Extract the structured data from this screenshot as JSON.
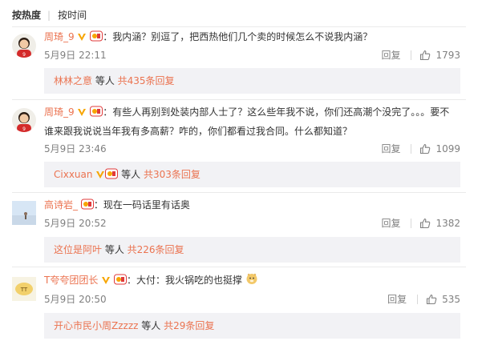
{
  "sort": {
    "hot": "按热度",
    "time": "按时间"
  },
  "comments": [
    {
      "name": "周琦_9",
      "text": "：我内涵？别逗了，把西热他们几个卖的时候怎么不说我内涵？",
      "time": "5月9日 22:11",
      "reply": "回复",
      "likes": "1793",
      "reply_name": "林林之意",
      "reply_mid": " 等人 ",
      "reply_count": "共435条回复"
    },
    {
      "name": "周琦_9",
      "text1": "：有些人再别到处装内部人士了？这么些年我不说，你们还高潮个没完了。。。要不",
      "text2": "谁来跟我说说当年我有多高薪？咋的，你们都看过我合同。什么都知道？",
      "time": "5月9日 23:46",
      "reply": "回复",
      "likes": "1099",
      "reply_name": "Cixxuan",
      "reply_mid": " 等人 ",
      "reply_count": "共303条回复"
    },
    {
      "name": "高诗岩_",
      "text": "：现在一码话里有话奥",
      "time": "5月9日 20:52",
      "reply": "回复",
      "likes": "1382",
      "reply_name": "这位是阿叶",
      "reply_mid": " 等人 ",
      "reply_count": "共226条回复"
    },
    {
      "name": "T夸夸团团长",
      "text": "：大付：我火锅吃的也挺撑",
      "time": "5月9日 20:50",
      "reply": "回复",
      "likes": "535",
      "reply_name": "开心市民小周Zzzzz",
      "reply_mid": " 等人 ",
      "reply_count": "共29条回复"
    }
  ],
  "colors": {
    "name": "#eb7350",
    "meta": "#808080",
    "replybg": "#f2f2f5",
    "badge_v": "#f7a500"
  },
  "icons": [
    "verified-v-icon",
    "vip-badge-icon",
    "thumbs-up-icon",
    "doge-emoji-icon"
  ]
}
